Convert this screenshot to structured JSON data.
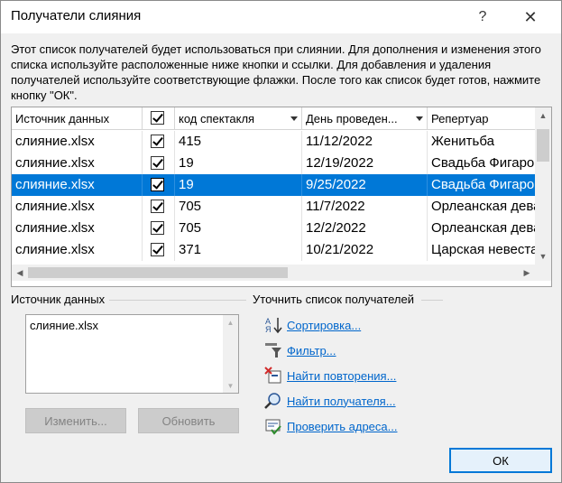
{
  "window": {
    "title": "Получатели слияния",
    "help_glyph": "?",
    "close_glyph": "✕"
  },
  "description": "Этот список получателей будет использоваться при слиянии. Для дополнения и изменения этого списка используйте расположенные ниже кнопки и ссылки. Для добавления и удаления получателей используйте соответствующие флажки. После того как список будет готов, нажмите кнопку \"ОК\".",
  "grid": {
    "columns": [
      "Источник данных",
      "",
      "код спектакля",
      "День проведен...",
      "Репертуар"
    ],
    "rows": [
      {
        "source": "слияние.xlsx",
        "checked": true,
        "code": "415",
        "date": "11/12/2022",
        "repertoire": "Женитьба",
        "selected": false
      },
      {
        "source": "слияние.xlsx",
        "checked": true,
        "code": "19",
        "date": "12/19/2022",
        "repertoire": "Свадьба Фигаро",
        "selected": false
      },
      {
        "source": "слияние.xlsx",
        "checked": true,
        "code": "19",
        "date": "9/25/2022",
        "repertoire": "Свадьба Фигаро",
        "selected": true
      },
      {
        "source": "слияние.xlsx",
        "checked": true,
        "code": "705",
        "date": "11/7/2022",
        "repertoire": "Орлеанская дева",
        "selected": false
      },
      {
        "source": "слияние.xlsx",
        "checked": true,
        "code": "705",
        "date": "12/2/2022",
        "repertoire": "Орлеанская дева",
        "selected": false
      },
      {
        "source": "слияние.xlsx",
        "checked": true,
        "code": "371",
        "date": "10/21/2022",
        "repertoire": "Царская невеста",
        "selected": false
      }
    ]
  },
  "data_source": {
    "label": "Источник данных",
    "items": [
      "слияние.xlsx"
    ],
    "edit_button": "Изменить...",
    "refresh_button": "Обновить"
  },
  "refine": {
    "label": "Уточнить список получателей",
    "links": [
      {
        "label": "Сортировка...",
        "icon": "sort-icon"
      },
      {
        "label": "Фильтр...",
        "icon": "filter-icon"
      },
      {
        "label": "Найти повторения...",
        "icon": "duplicates-icon"
      },
      {
        "label": "Найти получателя...",
        "icon": "find-recipient-icon"
      },
      {
        "label": "Проверить адреса...",
        "icon": "validate-addresses-icon"
      }
    ]
  },
  "ok_button": "ОК",
  "colors": {
    "selection": "#0078d7",
    "link": "#0066cc"
  }
}
